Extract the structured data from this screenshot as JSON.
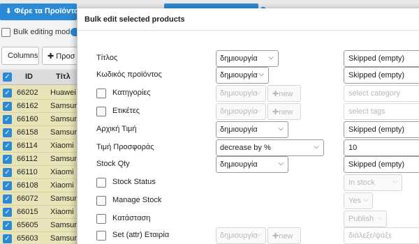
{
  "background": {
    "fetch_button": "Φέρε τα Προϊόντα",
    "bulk_editing_label": "Bulk editing mode",
    "columns_button": "Columns",
    "add_button": "Προσ",
    "table": {
      "headers": {
        "id": "ID",
        "title": "Τίτλ"
      },
      "rows": [
        {
          "id": "66202",
          "title": "Huawei"
        },
        {
          "id": "66162",
          "title": "Samsun"
        },
        {
          "id": "66160",
          "title": "Samsun"
        },
        {
          "id": "66158",
          "title": "Samsun"
        },
        {
          "id": "66114",
          "title": "Xiaomi"
        },
        {
          "id": "66112",
          "title": "Samsun"
        },
        {
          "id": "66110",
          "title": "Xiaomi"
        },
        {
          "id": "66108",
          "title": "Xiaomi"
        },
        {
          "id": "66072",
          "title": "Samsun"
        },
        {
          "id": "66015",
          "title": "Xiaomi"
        },
        {
          "id": "65605",
          "title": "Samsun"
        },
        {
          "id": "65603",
          "title": "Samsun"
        }
      ]
    }
  },
  "modal": {
    "title": "Bulk edit selected products",
    "rows": {
      "title": {
        "label": "Τίτλος",
        "action": "δημιουργία",
        "value": "Skipped (empty)"
      },
      "sku": {
        "label": "Κωδικός προϊόντος",
        "action": "δημιουργία",
        "value": "Skipped (empty)"
      },
      "categories": {
        "label": "Κατηγορίες",
        "action": "δημιουργία",
        "new_label": "new",
        "placeholder": "select category"
      },
      "tags": {
        "label": "Ετικέτες",
        "action": "δημιουργία",
        "new_label": "new",
        "placeholder": "select tags"
      },
      "regular_price": {
        "label": "Αρχική Τιμή",
        "action": "δημιουργία",
        "value": "Skipped (empty)"
      },
      "sale_price": {
        "label": "Τιμή Προσφοράς",
        "action": "decrease by %",
        "value": "10"
      },
      "stock_qty": {
        "label": "Stock Qty",
        "action": "δημιουργία",
        "value": "Skipped (empty)"
      },
      "stock_status": {
        "label": "Stock Status",
        "value": "In stock"
      },
      "manage_stock": {
        "label": "Manage Stock",
        "value": "Yes"
      },
      "status": {
        "label": "Κατάσταση",
        "value": "Publish"
      },
      "company": {
        "label": "Set (attr) Εταιρία",
        "action": "δημιουργία",
        "new_label": "new",
        "placeholder": "διάλεξε/ψάξε"
      }
    }
  },
  "colors": {
    "accent": "#2b8ad6",
    "table_bg": "#e9e4b7"
  }
}
